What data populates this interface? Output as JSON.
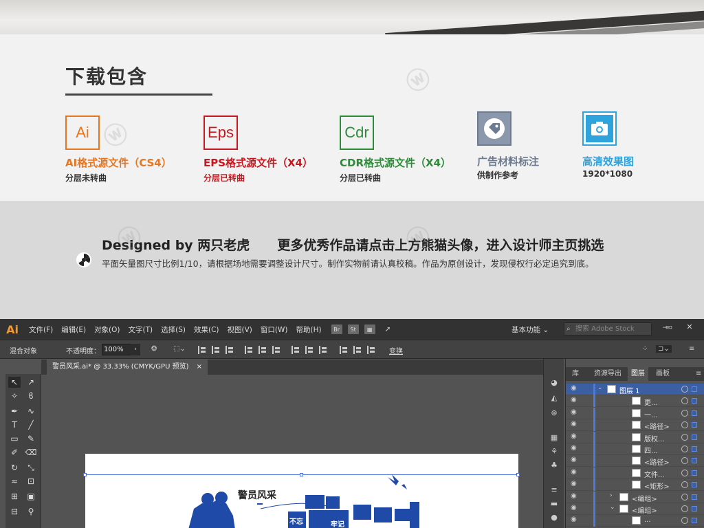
{
  "download": {
    "title": "下载包含",
    "formats": [
      {
        "icon": "Ai",
        "name": "AI格式源文件（CS4）",
        "sub": "分层未转曲"
      },
      {
        "icon": "Eps",
        "name": "EPS格式源文件（X4）",
        "sub": "分层已转曲"
      },
      {
        "icon": "Cdr",
        "name": "CDR格式源文件（X4）",
        "sub": "分层已转曲"
      },
      {
        "icon": "tag-icon",
        "name": "广告材料标注",
        "sub": "供制作参考"
      },
      {
        "icon": "camera-icon",
        "name": "高清效果图",
        "sub": "1920*1080"
      }
    ]
  },
  "designer": {
    "by": "Designed by 两只老虎",
    "more": "更多优秀作品请点击上方熊猫头像，进入设计师主页挑选",
    "note": "平面矢量图尺寸比例1/10，请根据场地需要调整设计尺寸。制作实物前请认真校稿。作品为原创设计，发现侵权行必定追究到底。"
  },
  "illustrator": {
    "logo": "Ai",
    "menu": [
      "文件(F)",
      "编辑(E)",
      "对象(O)",
      "文字(T)",
      "选择(S)",
      "效果(C)",
      "视图(V)",
      "窗口(W)",
      "帮助(H)"
    ],
    "menu_icons": [
      "Br",
      "St"
    ],
    "workspace": "基本功能 ⌄",
    "search_placeholder": "搜索 Adobe Stock",
    "window_buttons": [
      "—",
      "▭",
      "✕"
    ],
    "control": {
      "blend": "混合对象",
      "opacity_label": "不透明度：",
      "opacity_value": "100%",
      "transform": "变换"
    },
    "doc_tab": "警员风采.ai* @ 33.33% (CMYK/GPU 预览)",
    "doc_close": "×",
    "artwork_text": [
      "警员风采",
      "不忘",
      "牢记"
    ],
    "panel_tabs": [
      "库",
      "资源导出",
      "图层",
      "画板"
    ],
    "active_panel_tab": "图层",
    "layers": [
      {
        "label": "图层 1",
        "depth": 0,
        "expanded": true
      },
      {
        "label": "更...",
        "depth": 2
      },
      {
        "label": "一...",
        "depth": 2
      },
      {
        "label": "<路径>",
        "depth": 2
      },
      {
        "label": "版权...",
        "depth": 2
      },
      {
        "label": "四...",
        "depth": 2
      },
      {
        "label": "<路径>",
        "depth": 2
      },
      {
        "label": "文件...",
        "depth": 2
      },
      {
        "label": "<矩形>",
        "depth": 2
      },
      {
        "label": "<编组>",
        "depth": 1,
        "collapsed": true
      },
      {
        "label": "<编组>",
        "depth": 1,
        "expanded": true
      },
      {
        "label": "...",
        "depth": 2
      }
    ]
  },
  "colors": {
    "ai_orange": "#e8761f",
    "eps_red": "#c8171f",
    "cdr_green": "#2e8b3a",
    "tag_gray": "#6d7a8f",
    "hd_blue": "#2ea3dc",
    "police_blue": "#1f4aa8"
  }
}
